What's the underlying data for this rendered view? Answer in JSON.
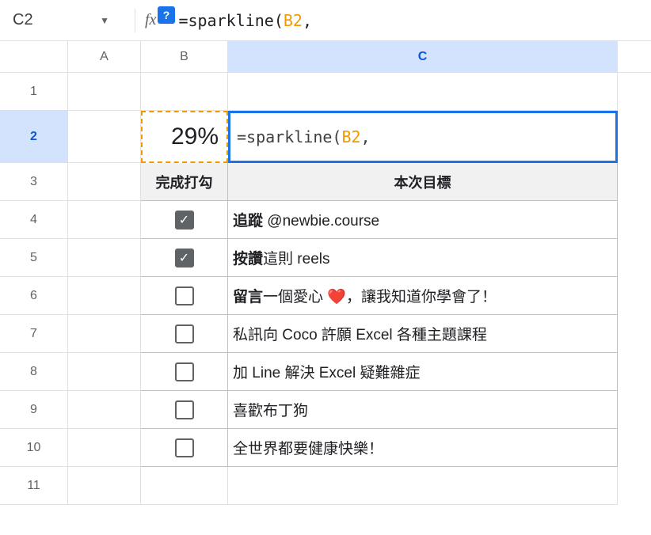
{
  "formula_bar": {
    "cell_reference": "C2",
    "fx_label": "fx",
    "help_icon": "?",
    "formula_prefix": "=sparkline(",
    "formula_ref": "B2",
    "formula_suffix": ", "
  },
  "columns": [
    "A",
    "B",
    "C"
  ],
  "active_column": "C",
  "rows": {
    "1": {},
    "2": {
      "active": true,
      "B": "29%",
      "C_prefix": "=sparkline(",
      "C_ref": "B2",
      "C_suffix": ", "
    },
    "3": {
      "B": "完成打勾",
      "C": "本次目標"
    },
    "4": {
      "checked": true,
      "C_bold": "追蹤",
      "C_rest": " @newbie.course"
    },
    "5": {
      "checked": true,
      "C_bold": "按讚",
      "C_rest": "這則 reels"
    },
    "6": {
      "checked": false,
      "C_bold": "留言",
      "C_rest": "一個愛心 ❤️，讓我知道你學會了！"
    },
    "7": {
      "checked": false,
      "C_plain": "私訊向 Coco 許願 Excel 各種主題課程"
    },
    "8": {
      "checked": false,
      "C_plain": "加 Line 解決 Excel 疑難雜症"
    },
    "9": {
      "checked": false,
      "C_plain": "喜歡布丁狗"
    },
    "10": {
      "checked": false,
      "C_plain": "全世界都要健康快樂！"
    },
    "11": {}
  }
}
